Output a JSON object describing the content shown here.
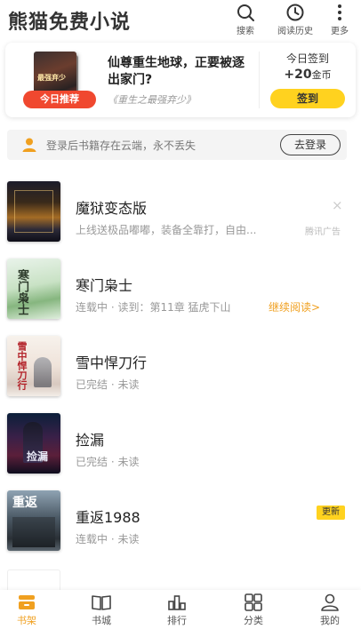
{
  "header": {
    "app_title": "熊猫免费小说",
    "search_label": "搜索",
    "history_label": "阅读历史",
    "more_label": "更多"
  },
  "recommend": {
    "badge": "今日推荐",
    "title": "仙尊重生地球，正要被逐出家门?",
    "subtitle": "《重生之最强弃少》",
    "cover_text": "最强弃少"
  },
  "sign_in": {
    "label": "今日签到",
    "reward_amount": "+20",
    "reward_unit": "金币",
    "button": "签到"
  },
  "login": {
    "text": "登录后书籍存在云端，永不丢失",
    "button": "去登录"
  },
  "books": [
    {
      "title": "魔狱变态版",
      "meta": "上线送极品嘟嘟，装备全靠打，自由...",
      "ad_label": "腾讯广告",
      "close": "×",
      "cover_text": ""
    },
    {
      "title": "寒门枭士",
      "meta": "连载中 · 读到：第11章  猛虎下山",
      "continue": "继续阅读>",
      "cover_text": "寒门枭士"
    },
    {
      "title": "雪中悍刀行",
      "meta": "已完结 · 未读",
      "cover_text": "雪中悍刀行"
    },
    {
      "title": "捡漏",
      "meta": "已完结 · 未读",
      "cover_text": "捡漏"
    },
    {
      "title": "重返1988",
      "meta": "连载中 · 未读",
      "badge": "更新",
      "cover_text": "重返"
    }
  ],
  "tabs": [
    {
      "label": "书架",
      "icon": "bookshelf-icon",
      "active": true
    },
    {
      "label": "书城",
      "icon": "book-store-icon",
      "active": false
    },
    {
      "label": "排行",
      "icon": "ranking-icon",
      "active": false
    },
    {
      "label": "分类",
      "icon": "category-grid-icon",
      "active": false
    },
    {
      "label": "我的",
      "icon": "profile-icon",
      "active": false
    }
  ],
  "colors": {
    "accent": "#f0a020",
    "sign_button": "#ffd21f",
    "recommend_badge": "#f0482f"
  }
}
